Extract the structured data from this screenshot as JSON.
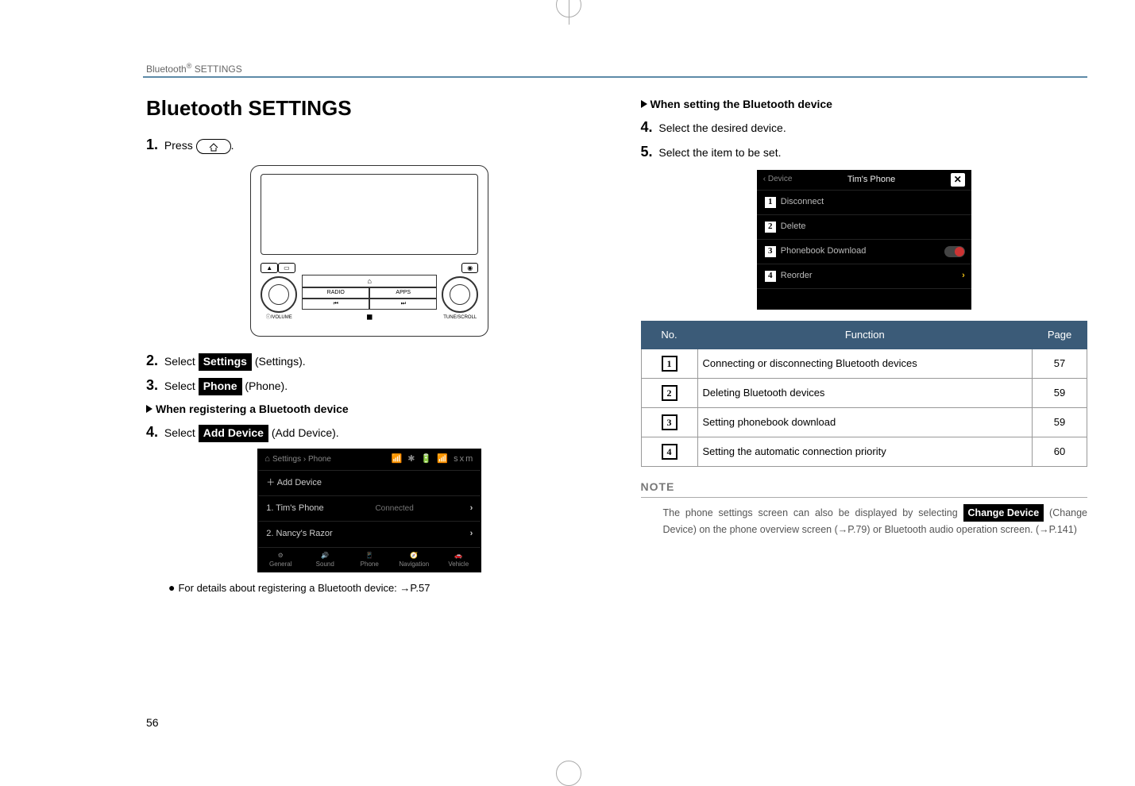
{
  "header": {
    "section": "Bluetooth® SETTINGS"
  },
  "left": {
    "title": "Bluetooth SETTINGS",
    "step1_pre": "Press",
    "step1_post": ".",
    "radio": {
      "vol_label": "VOLUME",
      "tune_label": "TUNE/SCROLL",
      "btn_radio": "RADIO",
      "btn_apps": "APPS",
      "btn_prev": "⏮",
      "btn_next": "⏭",
      "btn_sq": "◼"
    },
    "step2_pre": "Select",
    "step2_label": "Settings",
    "step2_post": "(Settings).",
    "step3_pre": "Select",
    "step3_label": "Phone",
    "step3_post": "(Phone).",
    "sub1": "When registering a Bluetooth device",
    "step4_pre": "Select",
    "step4_label": "Add Device",
    "step4_post": "(Add Device).",
    "shot": {
      "breadcrumb": "Settings › Phone",
      "icons": "📶 ✱ 🔋 📶 sxm",
      "add": "＋ Add Device",
      "row1": "1. Tim's Phone",
      "row1_status": "Connected",
      "row2": "2. Nancy's Razor",
      "bottom": [
        "General",
        "Sound",
        "Phone",
        "Navigation",
        "Vehicle"
      ]
    },
    "bullet": "For details about registering a Bluetooth device: →P.57"
  },
  "right": {
    "sub": "When setting the Bluetooth device",
    "step4": "Select the desired device.",
    "step5": "Select the item to be set.",
    "shot": {
      "back": "‹ Device",
      "title": "Tim's Phone",
      "rows": [
        "Disconnect",
        "Delete",
        "Phonebook Download",
        "Reorder"
      ]
    },
    "table": {
      "head_no": "No.",
      "head_func": "Function",
      "head_page": "Page",
      "rows": [
        {
          "n": "1",
          "func": "Connecting or disconnecting Bluetooth devices",
          "page": "57"
        },
        {
          "n": "2",
          "func": "Deleting Bluetooth devices",
          "page": "59"
        },
        {
          "n": "3",
          "func": "Setting phonebook download",
          "page": "59"
        },
        {
          "n": "4",
          "func": "Setting the automatic connection priority",
          "page": "60"
        }
      ]
    },
    "note_head": "NOTE",
    "note_pre": "The phone settings screen can also be displayed by selecting ",
    "note_label": "Change Device",
    "note_post": " (Change Device) on the phone overview screen (→P.79) or Bluetooth audio operation screen. (→P.141)"
  },
  "page_number": "56"
}
